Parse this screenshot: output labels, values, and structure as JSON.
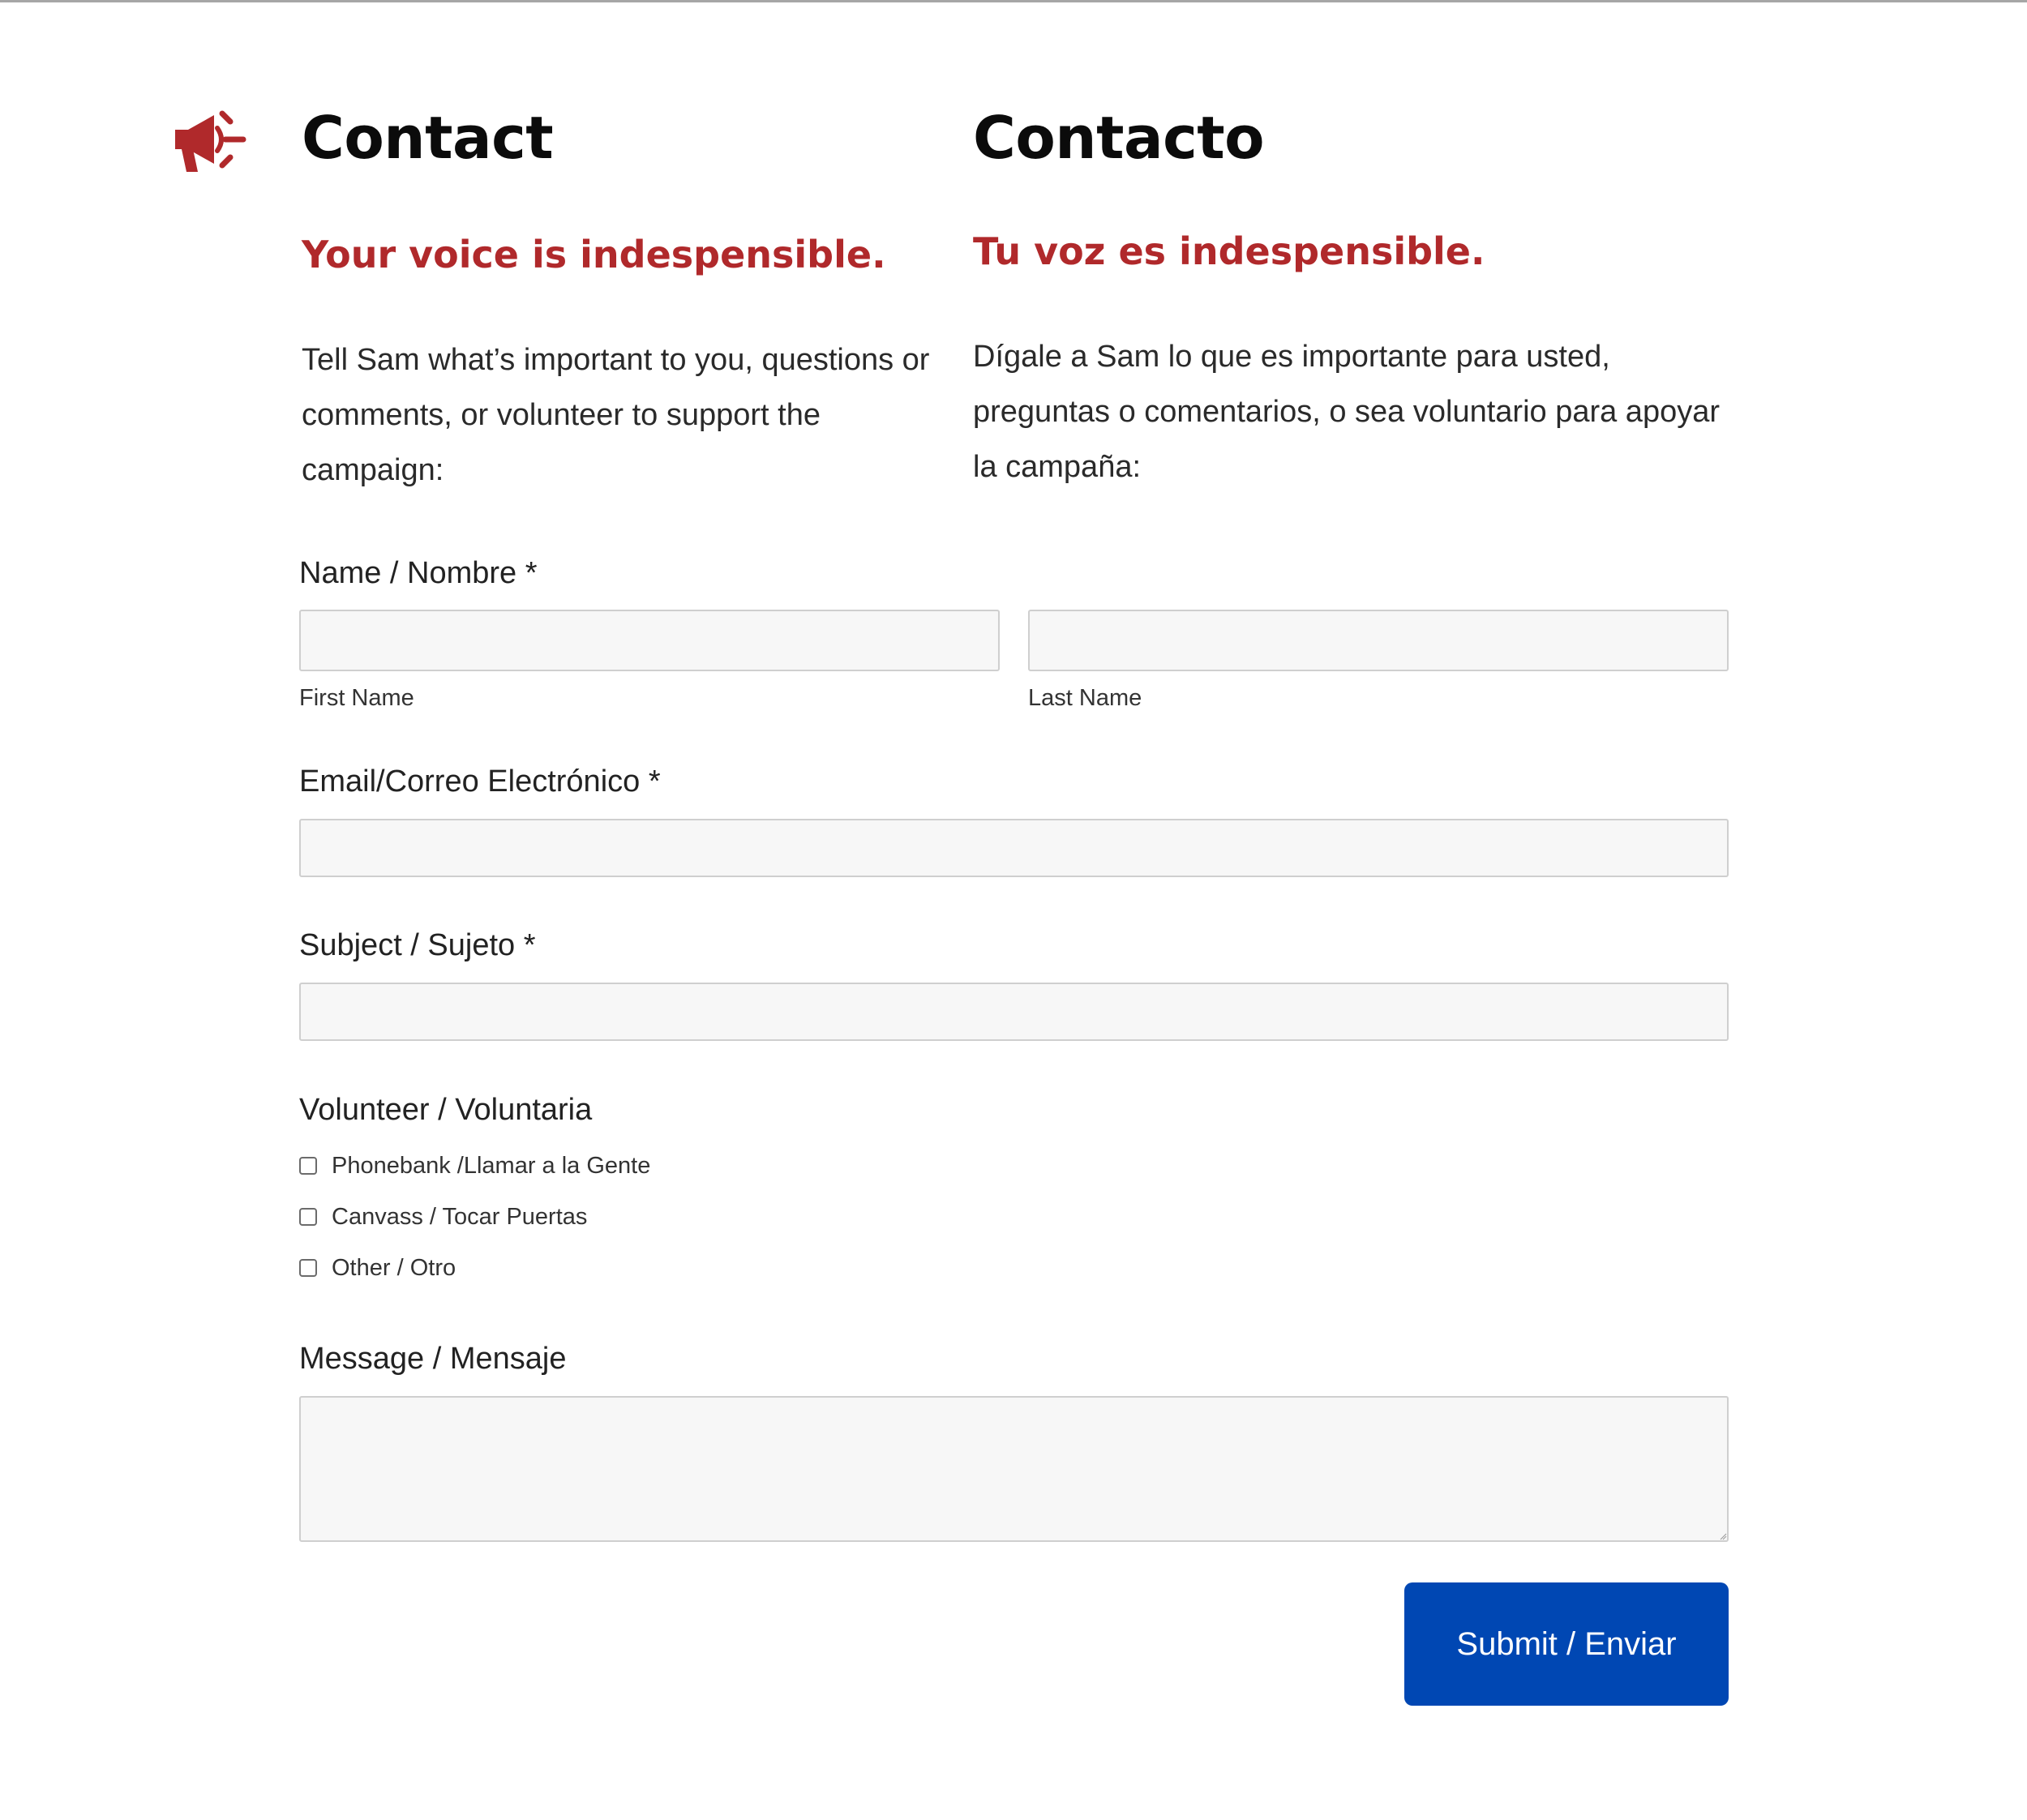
{
  "colors": {
    "accent_red": "#b0292b",
    "submit_blue": "#0047b3",
    "input_bg": "#f7f7f7",
    "input_border": "#cfcfcf"
  },
  "header_icon": "megaphone-icon",
  "english": {
    "heading": "Contact",
    "tagline": "Your voice is indespensible.",
    "intro": "Tell Sam what’s important to you, questions or comments, or volunteer to support the campaign:"
  },
  "spanish": {
    "heading": "Contacto",
    "tagline": "Tu voz es indespensible.",
    "intro": "Dígale a Sam lo que es importante para usted, preguntas o comentarios, o sea voluntario para apoyar la campaña:"
  },
  "form": {
    "name": {
      "label": "Name / Nombre *",
      "first_value": "",
      "first_sublabel": "First Name",
      "last_value": "",
      "last_sublabel": "Last Name"
    },
    "email": {
      "label": "Email/Correo Electrónico *",
      "value": ""
    },
    "subject": {
      "label": "Subject / Sujeto *",
      "value": ""
    },
    "volunteer": {
      "label": "Volunteer / Voluntaria",
      "options": [
        {
          "label": "Phonebank /Llamar a la Gente",
          "checked": false
        },
        {
          "label": "Canvass / Tocar Puertas",
          "checked": false
        },
        {
          "label": "Other / Otro",
          "checked": false
        }
      ]
    },
    "message": {
      "label": "Message / Mensaje",
      "value": ""
    },
    "submit_label": "Submit / Enviar"
  }
}
